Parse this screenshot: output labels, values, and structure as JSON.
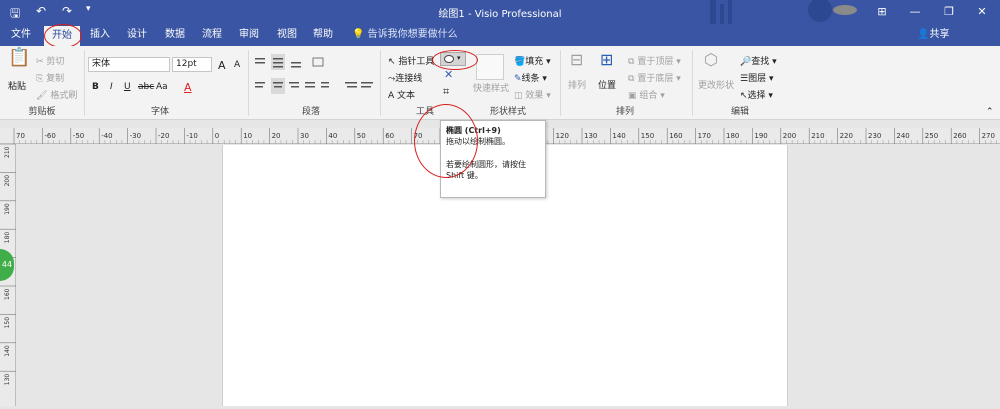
{
  "window": {
    "title": "绘图1 - Visio Professional",
    "minimize": "—",
    "restore": "❐",
    "close": "✕",
    "ribbon_display": "⊞"
  },
  "menu": {
    "tabs": [
      "文件",
      "开始",
      "插入",
      "设计",
      "数据",
      "流程",
      "审阅",
      "视图",
      "帮助"
    ],
    "active_tab": "开始",
    "tell_me": "告诉我你想要做什么",
    "share": "共享"
  },
  "clipboard": {
    "paste": "粘贴",
    "cut": "剪切",
    "copy": "复制",
    "format_painter": "格式刷",
    "label": "剪贴板"
  },
  "font": {
    "name": "宋体",
    "size": "12pt",
    "bold": "B",
    "italic": "I",
    "underline": "U",
    "strike": "abc",
    "case": "Aa",
    "color": "A",
    "grow": "A",
    "shrink": "A",
    "label": "字体"
  },
  "paragraph": {
    "label": "段落"
  },
  "tools": {
    "pointer": "指针工具",
    "connector": "连接线",
    "text": "文本",
    "label": "工具"
  },
  "shape_styles": {
    "quick_styles": "快速样式",
    "fill": "填充",
    "line": "线条",
    "effects": "效果",
    "label": "形状样式"
  },
  "arrange": {
    "align": "排列",
    "position": "位置",
    "bring_front": "置于顶层",
    "send_back": "置于底层",
    "group": "组合",
    "label": "排列"
  },
  "editing": {
    "change_shape": "更改形状",
    "find": "查找",
    "layers": "图层",
    "select": "选择",
    "label": "编辑"
  },
  "tooltip": {
    "title": "椭圆 (Ctrl+9)",
    "line1": "拖动以绘制椭圆。",
    "line2": "若要绘制圆形，请按住",
    "line3": "Shift 键。"
  },
  "h_ruler_labels": [
    "70",
    "-60",
    "-50",
    "-40",
    "-30",
    "-20",
    "-10",
    "0",
    "10",
    "20",
    "30",
    "40",
    "50",
    "60",
    "70",
    "80",
    "90",
    "100",
    "110",
    "120",
    "130",
    "140",
    "150",
    "160",
    "170",
    "180",
    "190",
    "200",
    "210",
    "220",
    "230",
    "240",
    "250",
    "260",
    "270"
  ],
  "v_ruler_labels": [
    "210",
    "200",
    "190",
    "180",
    "170",
    "160",
    "150",
    "140",
    "130"
  ],
  "side_badge": "44",
  "colors": {
    "title_bar": "#3955a3",
    "ribbon": "#f3f3f3",
    "highlight": "#d62020",
    "badge": "#3fae49"
  }
}
